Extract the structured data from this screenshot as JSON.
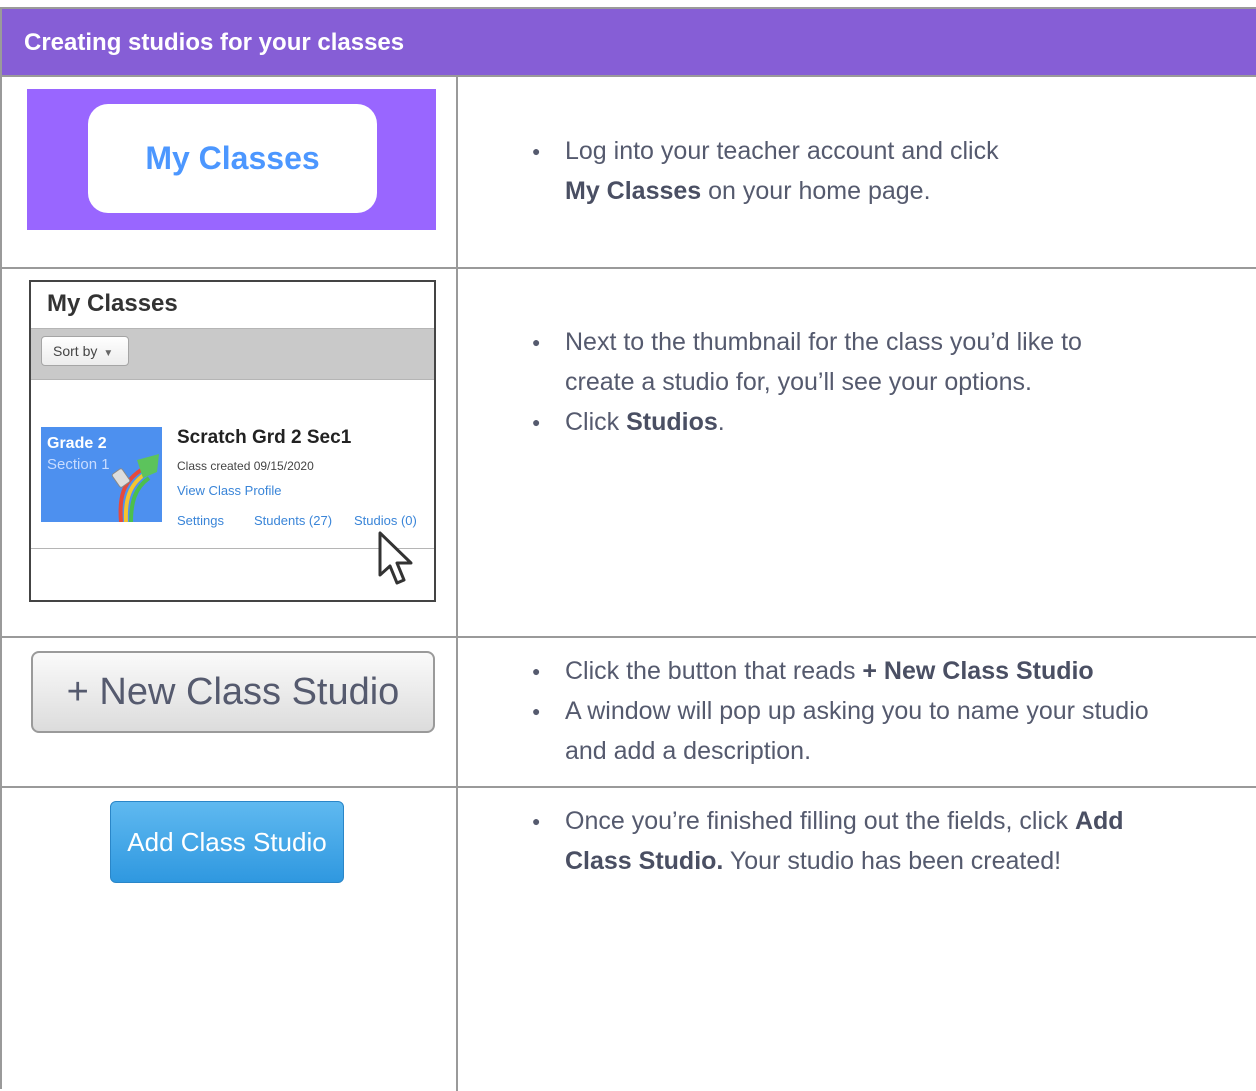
{
  "header": {
    "title": "Creating studios for your classes"
  },
  "colors": {
    "header_bg": "#865ed6",
    "scratch_purple": "#9966ff",
    "link_blue": "#3a85d8",
    "button_blue": "#2f98e0"
  },
  "row1": {
    "button_label": "My Classes",
    "bullets": [
      {
        "pre": "Log into your teacher account and click",
        "bold": "My Classes",
        "post": " on your home page."
      }
    ]
  },
  "row2": {
    "panel_title": "My Classes",
    "sort_label": "Sort by",
    "thumb_grade": "Grade 2",
    "thumb_section": "Section 1",
    "class_name": "Scratch Grd 2 Sec1",
    "class_created": "Class created 09/15/2020",
    "view_profile": "View Class Profile",
    "settings": "Settings",
    "students": "Students (27)",
    "studios": "Studios (0)",
    "bullets": [
      {
        "line1": "Next to the thumbnail for the class you’d like to",
        "line2": "create a studio for, you’ll see your options."
      },
      {
        "pre": "Click ",
        "bold": "Studios",
        "post": "."
      }
    ]
  },
  "row3": {
    "button_label": "+ New Class Studio",
    "bullets": [
      {
        "pre": "Click the button that reads ",
        "bold": "+ New Class Studio"
      },
      {
        "line1": "A window will pop up asking you to name your studio",
        "line2": "and add a description."
      }
    ]
  },
  "row4": {
    "button_label": "Add Class Studio",
    "bullets": [
      {
        "pre": "Once you’re finished filling out the fields, click ",
        "bold1": "Add",
        "bold2": "Class Studio.",
        "post": " Your studio has been created!"
      }
    ]
  }
}
